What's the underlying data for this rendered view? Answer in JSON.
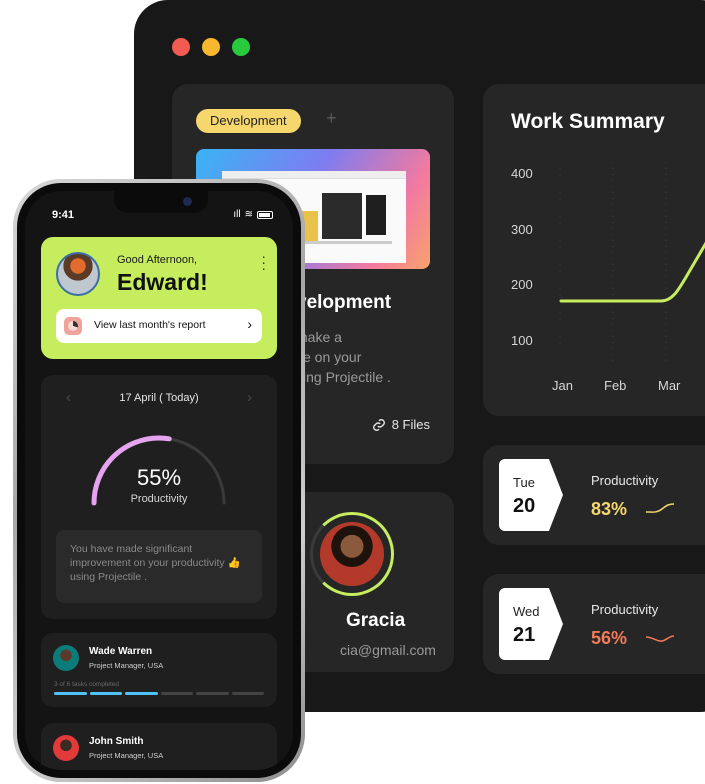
{
  "desktop": {
    "traffic_lights": [
      "#f15b52",
      "#f7b82f",
      "#29c93e"
    ],
    "project": {
      "tag": "Development",
      "add_tag": "+",
      "title": "velopment",
      "description_lines": [
        "make a",
        "ve on your",
        "sing Projectile ."
      ],
      "files": "8 Files"
    },
    "person": {
      "name": "Gracia",
      "email": "cia@gmail.com"
    },
    "work_summary": {
      "title": "Work Summary"
    },
    "day_cards": [
      {
        "day": "Tue",
        "date": "20",
        "label": "Productivity",
        "value": "83%",
        "color": "#f5d76e"
      },
      {
        "day": "Wed",
        "date": "21",
        "label": "Productivity",
        "value": "56%",
        "color": "#f07a5a"
      }
    ]
  },
  "chart_data": {
    "type": "line",
    "title": "Work Summary",
    "categories": [
      "Jan",
      "Feb",
      "Mar"
    ],
    "y_ticks": [
      400,
      300,
      200,
      100
    ],
    "ylim": [
      100,
      400
    ],
    "series": [
      {
        "values": [
          180,
          180,
          180
        ],
        "color": "#c6ed5e"
      }
    ],
    "grid": false
  },
  "phone": {
    "status": {
      "time": "9:41",
      "signal": "ıll",
      "wifi": "≋"
    },
    "greeting": {
      "small": "Good Afternoon,",
      "name": "Edward!",
      "report_label": "View last month's report",
      "report_arrow": "›"
    },
    "productivity": {
      "date": "17 April ( Today)",
      "prev": "‹",
      "next": "›",
      "percent": "55%",
      "percent_value": 55,
      "label": "Productivity",
      "message": "You have made  significant improvement on your productivity 👍 using Projectile ."
    },
    "members": [
      {
        "name": "Wade Warren",
        "role": "Project Manager, USA",
        "tasks": "3 of 6 tasks completed",
        "completed": 3,
        "total": 6
      },
      {
        "name": "John Smith",
        "role": "Project Manager, USA"
      }
    ]
  }
}
